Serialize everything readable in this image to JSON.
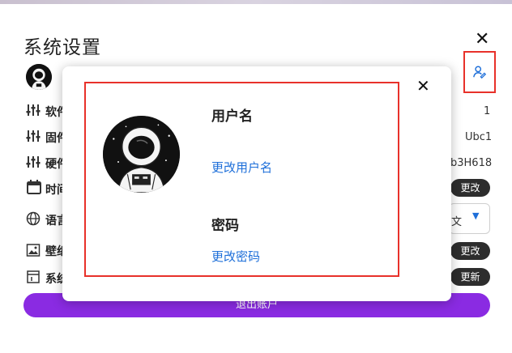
{
  "settings": {
    "title": "系统设置",
    "rows": [
      {
        "label": "软件",
        "value": "1",
        "icon": "sliders-icon"
      },
      {
        "label": "固件",
        "value": "Ubc1",
        "icon": "sliders-icon"
      },
      {
        "label": "硬件",
        "value": "b3H618",
        "icon": "sliders-icon"
      },
      {
        "label": "时间",
        "button": "更改",
        "icon": "calendar-icon"
      },
      {
        "label": "语言",
        "select_value": "文",
        "icon": "globe-icon"
      },
      {
        "label": "壁纸",
        "button": "更改",
        "icon": "image-icon"
      },
      {
        "label": "系统",
        "button": "更新",
        "icon": "system-icon"
      }
    ],
    "logout_label": "退出账户"
  },
  "user_dialog": {
    "username_heading": "用户名",
    "change_username_link": "更改用户名",
    "password_heading": "密码",
    "change_password_link": "更改密码"
  },
  "colors": {
    "accent_purple": "#8a2be2",
    "link_blue": "#1e6fd9",
    "highlight_red": "#e8312a",
    "pill_dark": "#2d2d2d"
  }
}
